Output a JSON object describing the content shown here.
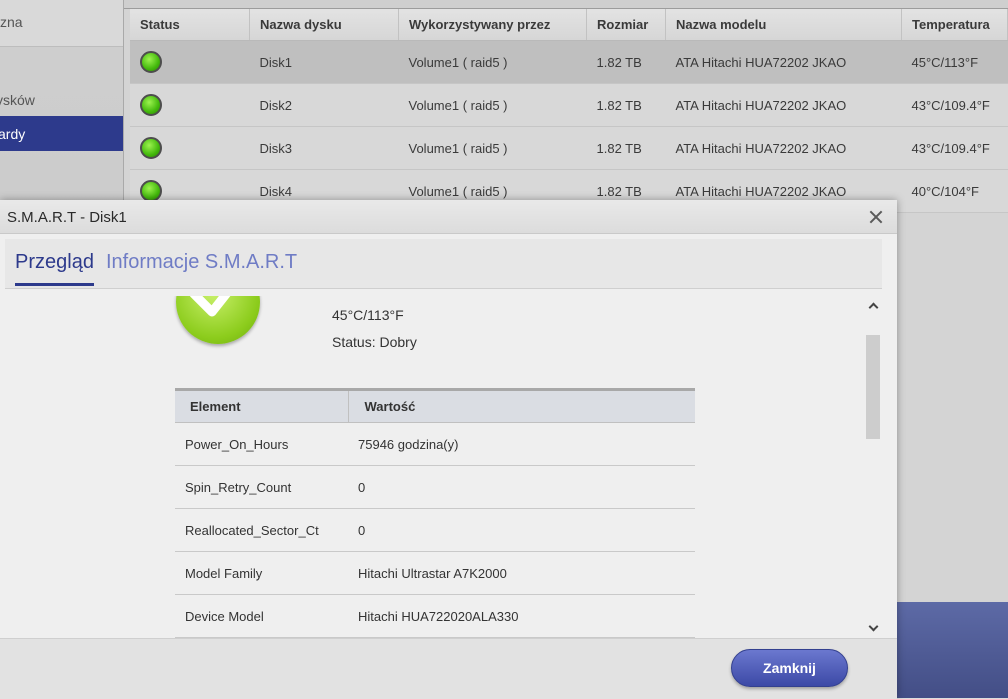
{
  "sidebar": {
    "items": [
      {
        "label": "zna"
      },
      {
        "label": "ysków"
      },
      {
        "label": "ardy"
      }
    ]
  },
  "disk_table": {
    "headers": [
      "Status",
      "Nazwa dysku",
      "Wykorzystywany przez",
      "Rozmiar",
      "Nazwa modelu",
      "Temperatura"
    ],
    "rows": [
      {
        "name": "Disk1",
        "used_by": "Volume1 ( raid5 )",
        "size": "1.82 TB",
        "model": "ATA Hitachi HUA72202 JKAO",
        "temp": "45°C/113°F",
        "status": "ok"
      },
      {
        "name": "Disk2",
        "used_by": "Volume1 ( raid5 )",
        "size": "1.82 TB",
        "model": "ATA Hitachi HUA72202 JKAO",
        "temp": "43°C/109.4°F",
        "status": "ok"
      },
      {
        "name": "Disk3",
        "used_by": "Volume1 ( raid5 )",
        "size": "1.82 TB",
        "model": "ATA Hitachi HUA72202 JKAO",
        "temp": "43°C/109.4°F",
        "status": "ok"
      },
      {
        "name": "Disk4",
        "used_by": "Volume1 ( raid5 )",
        "size": "1.82 TB",
        "model": "ATA Hitachi HUA72202 JKAO",
        "temp": "40°C/104°F",
        "status": "ok"
      }
    ]
  },
  "dialog": {
    "title": "S.M.A.R.T - Disk1",
    "tabs": [
      {
        "label": "Przegląd",
        "active": true
      },
      {
        "label": "Informacje S.M.A.R.T",
        "active": false
      }
    ],
    "overview": {
      "temperature": "45°C/113°F",
      "status_label": "Status:",
      "status_value": "Dobry",
      "icon": "check-icon"
    },
    "smart_table": {
      "headers": [
        "Element",
        "Wartość"
      ],
      "rows": [
        {
          "element": "Power_On_Hours",
          "value": "75946 godzina(y)"
        },
        {
          "element": "Spin_Retry_Count",
          "value": "0"
        },
        {
          "element": "Reallocated_Sector_Ct",
          "value": "0"
        },
        {
          "element": "Model Family",
          "value": "Hitachi Ultrastar A7K2000"
        },
        {
          "element": "Device Model",
          "value": "Hitachi HUA722020ALA330"
        }
      ]
    },
    "close_button": "Zamknij"
  },
  "colors": {
    "accent": "#2d3a8c",
    "tab_inactive": "#6f7cc5",
    "status_ok": "#43b90c"
  }
}
